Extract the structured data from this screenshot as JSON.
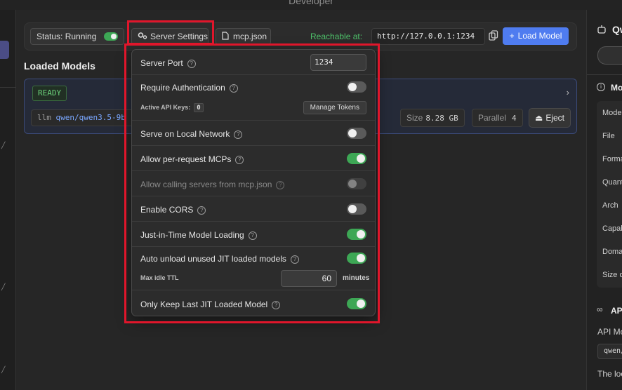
{
  "window": {
    "title": "Developer"
  },
  "toolbar": {
    "status_label": "Status: Running",
    "status_on": true,
    "server_settings_label": "Server Settings",
    "mcp_json_label": "mcp.json",
    "reachable_label": "Reachable at:",
    "url": "http://127.0.0.1:1234",
    "load_model_label": "Load Model"
  },
  "loaded_models": {
    "title": "Loaded Models",
    "status_badge": "READY",
    "command_prefix": "llm",
    "model_id": "qwen/qwen3.5-9b",
    "size_label": "Size",
    "size_value": "8.28 GB",
    "parallel_label": "Parallel",
    "parallel_value": "4",
    "eject_label": "Eject"
  },
  "server_settings": {
    "server_port_label": "Server Port",
    "server_port_value": "1234",
    "require_auth_label": "Require Authentication",
    "require_auth_on": false,
    "active_keys_label": "Active API Keys:",
    "active_keys_count": "0",
    "manage_tokens_label": "Manage Tokens",
    "serve_local_label": "Serve on Local Network",
    "serve_local_on": false,
    "per_request_mcps_label": "Allow per-request MCPs",
    "per_request_mcps_on": true,
    "calling_servers_label": "Allow calling servers from mcp.json",
    "calling_servers_on": false,
    "cors_label": "Enable CORS",
    "cors_on": false,
    "jit_label": "Just-in-Time Model Loading",
    "jit_on": true,
    "auto_unload_label": "Auto unload unused JIT loaded models",
    "auto_unload_on": true,
    "max_idle_label": "Max idle TTL",
    "max_idle_value": "60",
    "max_idle_unit": "minutes",
    "keep_last_label": "Only Keep Last JIT Loaded Model",
    "keep_last_on": true
  },
  "right_panel": {
    "title": "Qwen",
    "info_section": "Model",
    "rows": [
      "Model",
      "File",
      "Format",
      "Quantization",
      "Arch",
      "Capabilities",
      "Domain",
      "Size on disk"
    ],
    "api_section": "API",
    "api_model_label": "API Model",
    "api_model_value": "qwen/",
    "load_note": "The local"
  },
  "colors": {
    "accent": "#4f7cf0",
    "toggle_on": "#3da755",
    "highlight": "#e0162b",
    "reachable": "#4ec16a"
  }
}
